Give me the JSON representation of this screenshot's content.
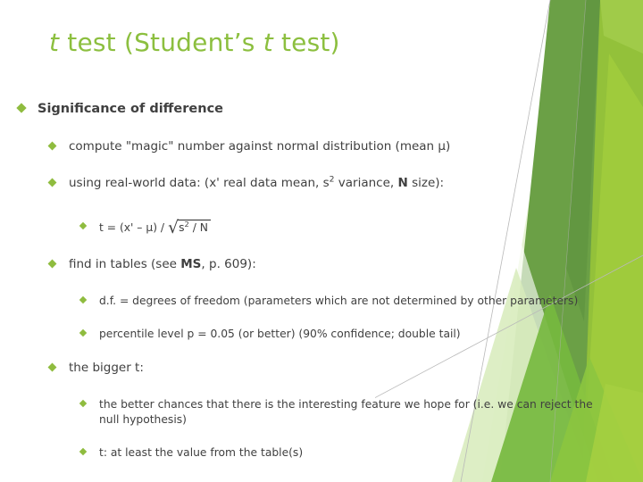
{
  "slide": {
    "title": {
      "prefix_italic": "t",
      "part1": " test (Student’s ",
      "mid_italic": "t",
      "part2": " test)"
    },
    "theme": {
      "accent_green": "#8cbf3f",
      "bullet_green": "#8fbc3f",
      "dark_band_green": "#6ba046",
      "bright_band_green": "#80b833",
      "pale_band_green": "#d9ecc0",
      "text_gray": "#404040",
      "background": "#ffffff"
    },
    "bullets": {
      "level1": "Significance of difference",
      "item_compute": "compute \"magic\" number against normal distribution (mean μ)",
      "item_using_pre": "using real-world data: (x' real data mean, s",
      "item_using_sup": "2",
      "item_using_post": " variance, ",
      "item_using_bold": "N",
      "item_using_end": " size):",
      "formula_lead": "t = (x' – μ) / ",
      "formula_radical_sign": "√",
      "formula_radicand_pre": "s",
      "formula_radicand_sup": "2",
      "formula_radicand_post": " / N",
      "item_find_pre": "find in tables (see ",
      "item_find_bold": "MS",
      "item_find_post": ", p. 609):",
      "item_df": "d.f. = degrees of freedom (parameters which are not determined by other parameters)",
      "item_percentile": "percentile level p = 0.05 (or better) (90% confidence; double tail)",
      "item_bigger_t": "the bigger t:",
      "item_better_chances": "the better chances that there is the interesting feature we hope for (i.e. we can reject the null hypothesis)",
      "item_at_least": "t: at least the value from the table(s)"
    }
  }
}
